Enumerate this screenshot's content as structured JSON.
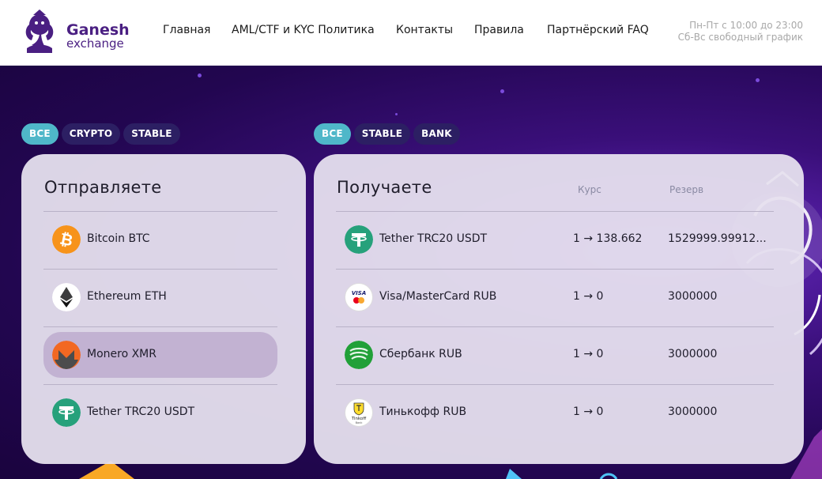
{
  "header": {
    "logo_title": "Ganesh",
    "logo_sub": "exchange",
    "nav": [
      {
        "label": "Главная"
      },
      {
        "label": "AML/CTF и KYC Политика"
      },
      {
        "label": "Контакты"
      },
      {
        "label": "Правила"
      },
      {
        "label": "Партнёрский FAQ"
      }
    ],
    "hours_line1": "Пн-Пт с 10:00 до 23:00",
    "hours_line2": "Сб-Вс свободный график"
  },
  "send": {
    "filters": [
      {
        "label": "ВСЕ",
        "active": true
      },
      {
        "label": "CRYPTO",
        "active": false
      },
      {
        "label": "STABLE",
        "active": false
      }
    ],
    "title": "Отправляете",
    "items": [
      {
        "label": "Bitcoin BTC",
        "icon": "bitcoin-icon",
        "selected": false
      },
      {
        "label": "Ethereum ETH",
        "icon": "ethereum-icon",
        "selected": false
      },
      {
        "label": "Monero XMR",
        "icon": "monero-icon",
        "selected": true
      },
      {
        "label": "Tether TRC20 USDT",
        "icon": "tether-icon",
        "selected": false
      }
    ]
  },
  "receive": {
    "filters": [
      {
        "label": "ВСЕ",
        "active": true
      },
      {
        "label": "STABLE",
        "active": false
      },
      {
        "label": "BANK",
        "active": false
      }
    ],
    "title": "Получаете",
    "col_rate": "Курс",
    "col_reserve": "Резерв",
    "items": [
      {
        "label": "Tether TRC20 USDT",
        "icon": "tether-icon",
        "rate": "1 → 138.662",
        "reserve": "1529999.99912..."
      },
      {
        "label": "Visa/MasterCard RUB",
        "icon": "visa-mastercard-icon",
        "rate": "1 → 0",
        "reserve": "3000000"
      },
      {
        "label": "Сбербанк RUB",
        "icon": "sberbank-icon",
        "rate": "1 → 0",
        "reserve": "3000000"
      },
      {
        "label": "Тинькофф RUB",
        "icon": "tinkoff-icon",
        "rate": "1 → 0",
        "reserve": "3000000"
      }
    ]
  },
  "colors": {
    "brand": "#4a1f82",
    "filter_active": "#4fb7c9",
    "filter_inactive": "#2c1f63",
    "bitcoin": "#f7931a",
    "tether": "#26a17b",
    "monero": "#f26822",
    "sberbank": "#21a038"
  }
}
